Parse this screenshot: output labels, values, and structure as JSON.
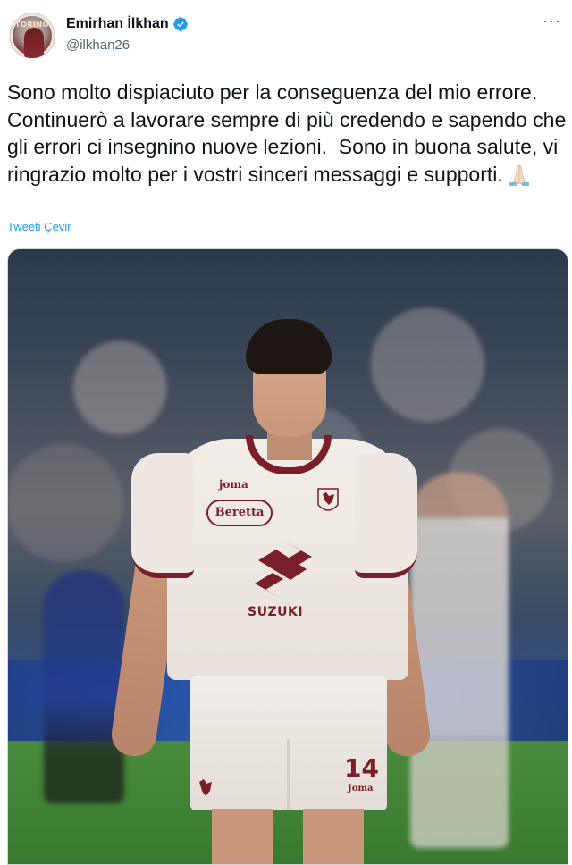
{
  "author": {
    "display_name": "Emirhan İlkhan",
    "handle": "@ilkhan26",
    "verified": true,
    "avatar_badge_text": "TORINO"
  },
  "tweet": {
    "text": "Sono molto dispiaciuto per la conseguenza del mio errore.  Continuerò a lavorare sempre di più credendo e sapendo che gli errori ci insegnino nuove lezioni.  Sono in buona salute, vi ringrazio molto per i vostri sinceri messaggi e supporti.",
    "emoji": "folded-hands",
    "translate_label": "Tweeti Çevir"
  },
  "media": {
    "jersey_brand": "joma",
    "sponsor_main": "Beretta",
    "sponsor_chest": "SUZUKI",
    "shorts_number": "14",
    "shorts_brand": "Joma"
  },
  "colors": {
    "text": "#0f1419",
    "secondary": "#536471",
    "link": "#1d9bf0",
    "verified": "#1d9bf0",
    "torino_maroon": "#7a1e2a"
  }
}
